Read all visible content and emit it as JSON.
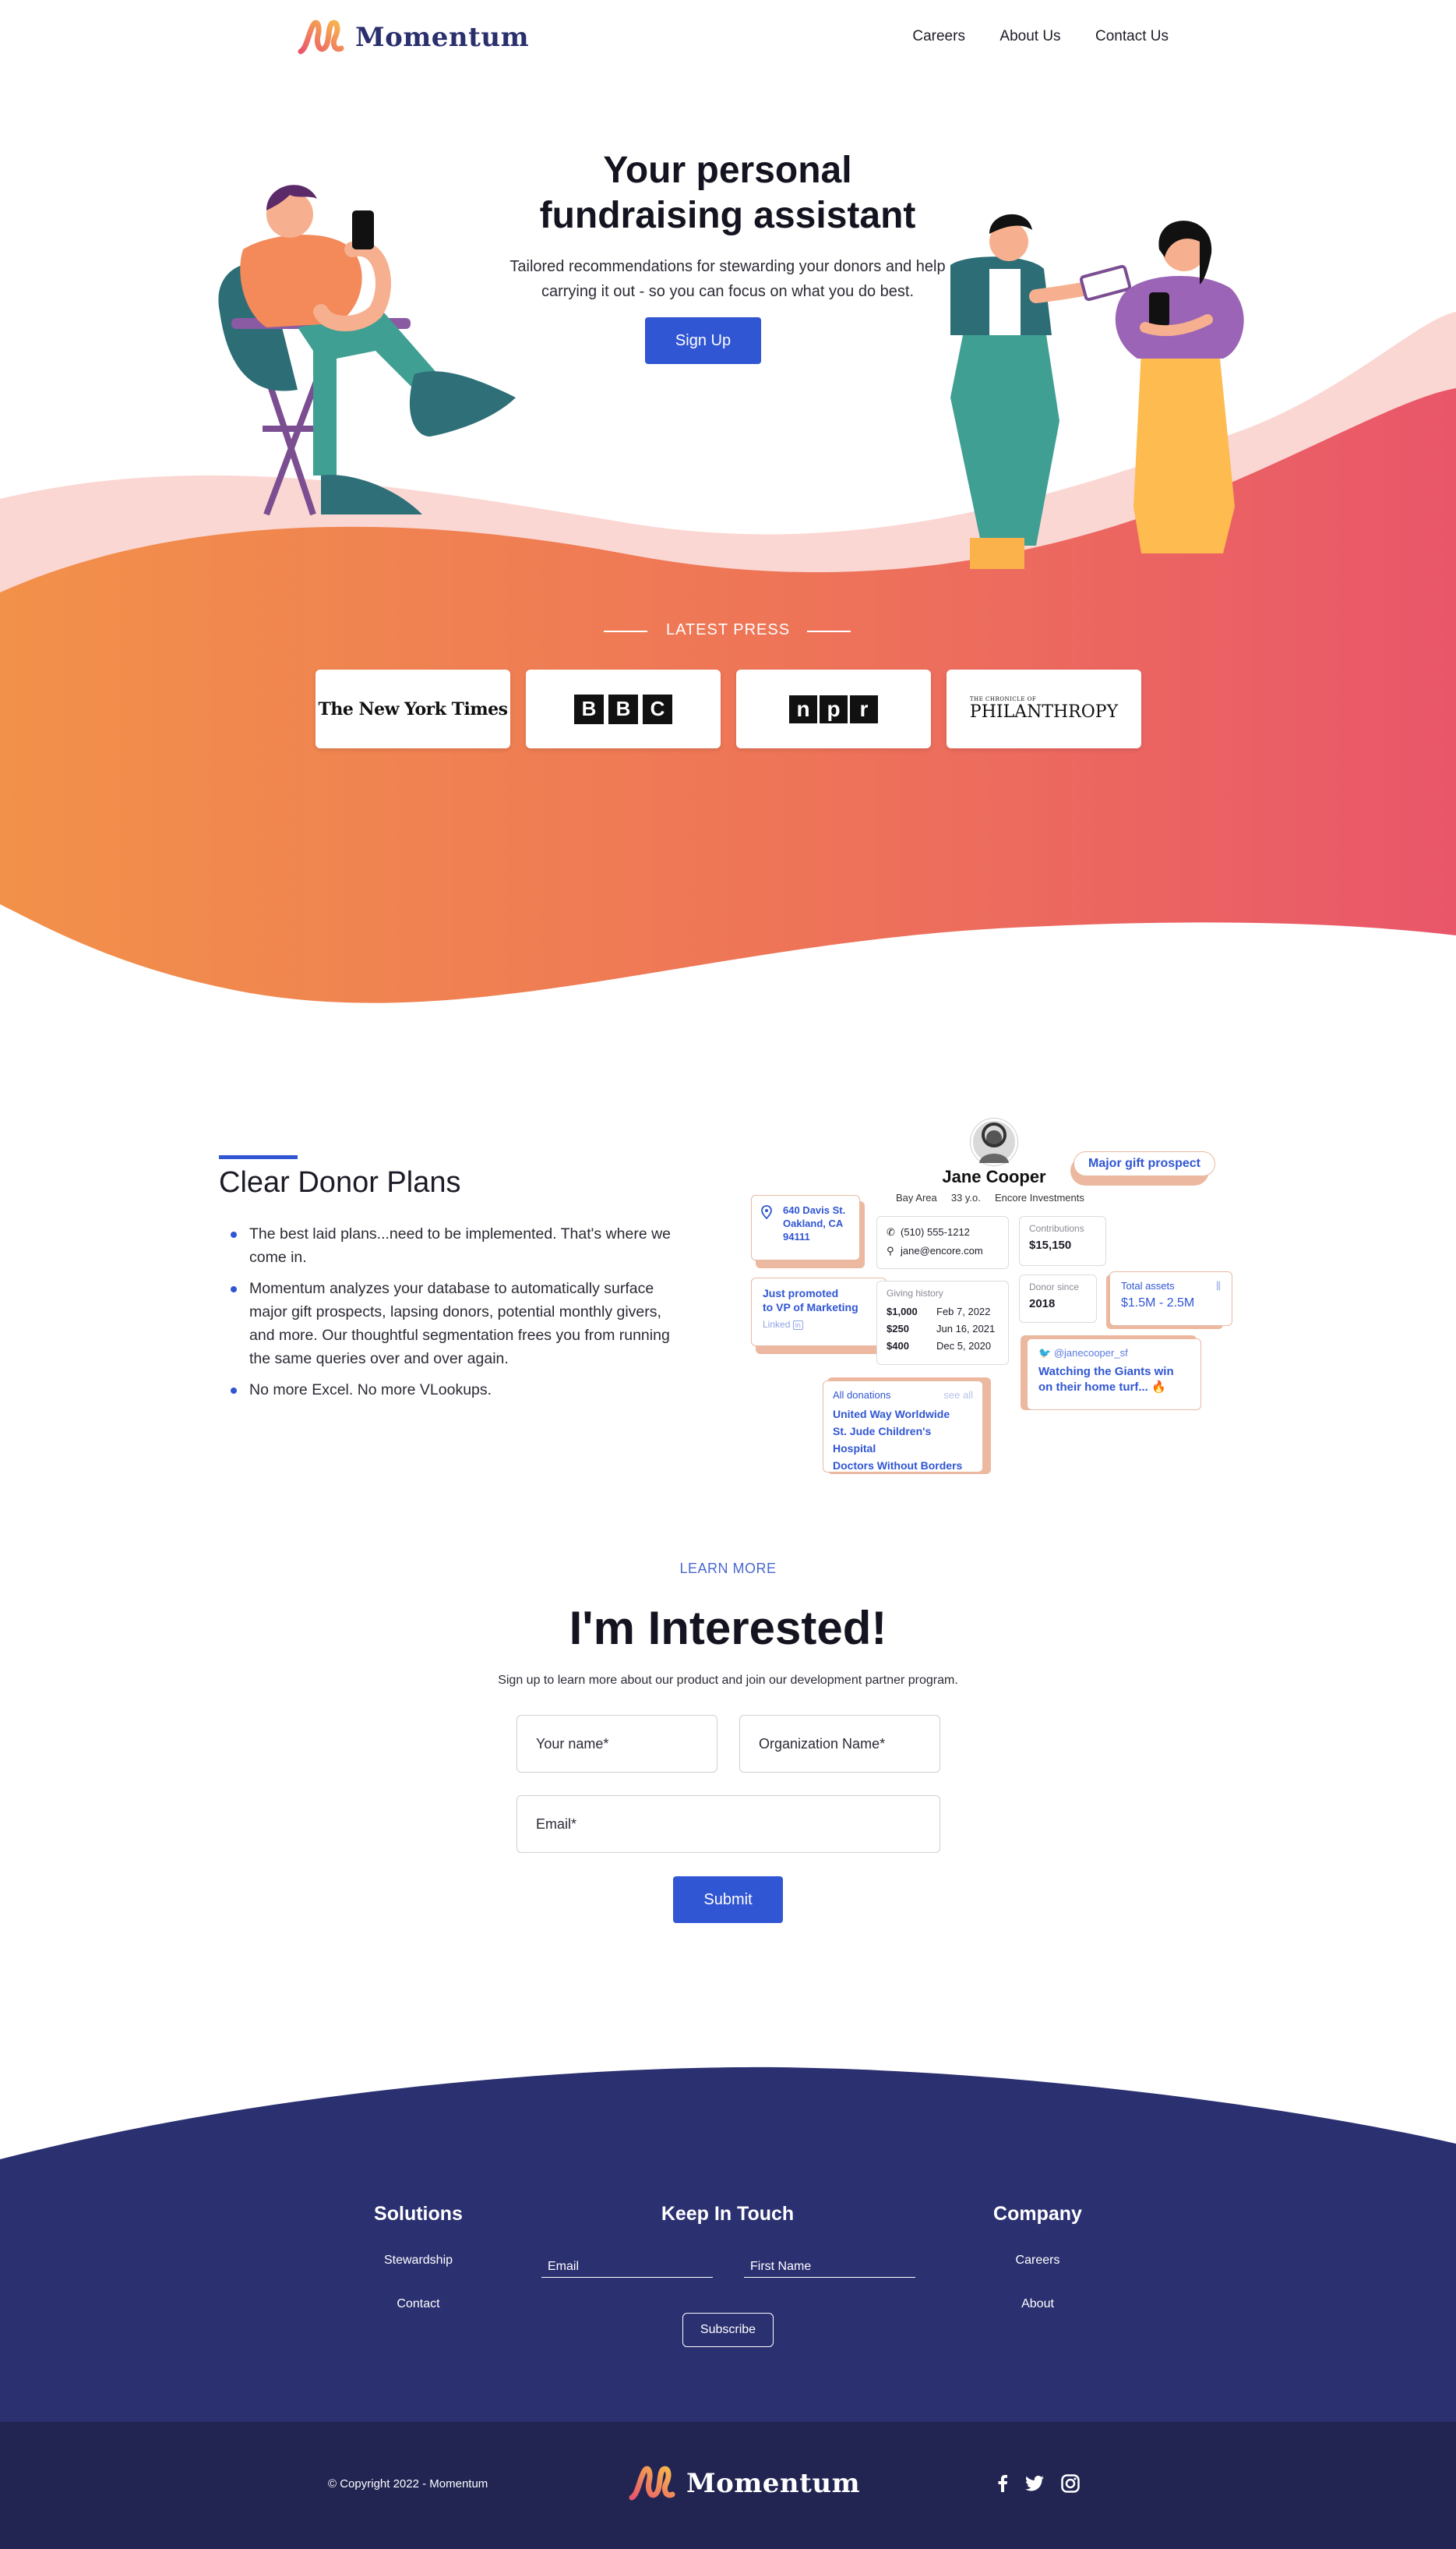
{
  "header": {
    "logo_text": "Momentum",
    "nav": [
      "Careers",
      "About Us",
      "Contact Us"
    ]
  },
  "hero": {
    "title_line1": "Your personal",
    "title_line2": "fundraising assistant",
    "subtitle_line1": "Tailored recommendations for stewarding your donors and help",
    "subtitle_line2": "carrying it out - so you can focus on what you do best.",
    "cta": "Sign Up"
  },
  "press": {
    "label": "LATEST PRESS",
    "logos": [
      "The New York Times",
      "BBC",
      "npr",
      "PHILANTHROPY"
    ],
    "bbc_letters": [
      "B",
      "B",
      "C"
    ],
    "npr_letters": [
      "n",
      "p",
      "r"
    ],
    "phil_small": "THE CHRONICLE OF"
  },
  "donor_plans": {
    "title": "Clear Donor Plans",
    "bullets": [
      "The best laid plans...need to be implemented. That's where we come in.",
      "Momentum analyzes your database to automatically surface major gift prospects, lapsing donors, potential monthly givers, and more. Our thoughtful segmentation frees you from running the same queries over and over again.",
      "No more Excel. No more VLookups."
    ],
    "profile": {
      "name": "Jane Cooper",
      "location": "Bay Area",
      "age": "33 y.o.",
      "company": "Encore Investments",
      "badge": "Major gift prospect",
      "address": [
        "640 Davis St.",
        "Oakland, CA",
        "94111"
      ],
      "phone": "(510) 555-1212",
      "email": "jane@encore.com",
      "contributions_label": "Contributions",
      "contributions": "$15,150",
      "promotion": [
        "Just promoted",
        "to VP of Marketing"
      ],
      "promotion_source": "Linked",
      "giving_history_label": "Giving history",
      "giving_history": [
        {
          "amount": "$1,000",
          "date": "Feb 7, 2022"
        },
        {
          "amount": "$250",
          "date": "Jun 16, 2021"
        },
        {
          "amount": "$400",
          "date": "Dec 5, 2020"
        }
      ],
      "donor_since_label": "Donor since",
      "donor_since": "2018",
      "total_assets_label": "Total assets",
      "total_assets": "$1.5M - 2.5M",
      "twitter_handle": "@janecooper_sf",
      "tweet": [
        "Watching the Giants win",
        "on their home turf... 🔥"
      ],
      "all_donations_label": "All donations",
      "see_all": "see all",
      "donations": [
        "United Way Worldwide",
        "St. Jude Children's Hospital",
        "Doctors Without Borders"
      ]
    }
  },
  "interested": {
    "eyebrow": "LEARN MORE",
    "title": "I'm Interested!",
    "subtitle": "Sign up to learn more about our product and join our development partner program.",
    "name_placeholder": "Your name*",
    "org_placeholder": "Organization Name*",
    "email_placeholder": "Email*",
    "submit": "Submit"
  },
  "footer": {
    "solutions_title": "Solutions",
    "solutions_links": [
      "Stewardship",
      "Contact"
    ],
    "keep_title": "Keep In Touch",
    "email_placeholder": "Email",
    "first_name_placeholder": "First Name",
    "subscribe": "Subscribe",
    "company_title": "Company",
    "company_links": [
      "Careers",
      "About"
    ],
    "copyright": "© Copyright 2022 - Momentum",
    "logo_text": "Momentum"
  },
  "colors": {
    "primary": "#3056d3",
    "navy": "#2b3070",
    "navy_dark": "#222552",
    "orange": "#f2914a",
    "coral": "#e9566a"
  }
}
